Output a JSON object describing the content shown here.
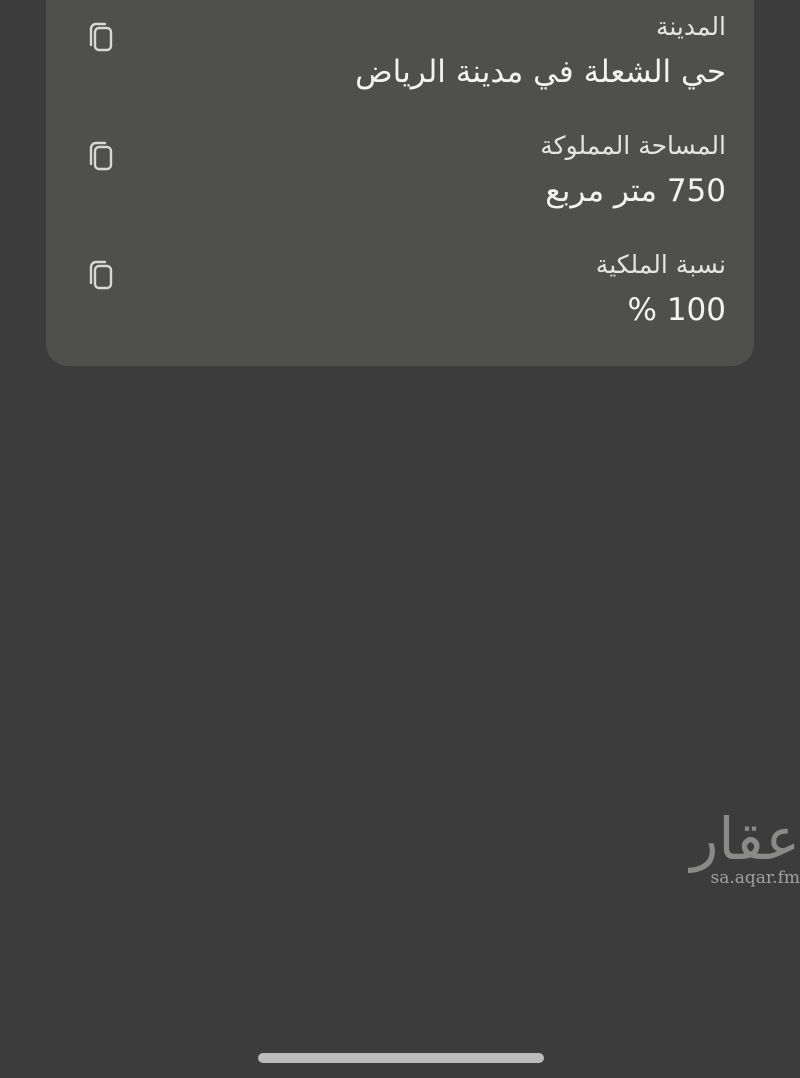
{
  "details": {
    "items": [
      {
        "label": "المدينة",
        "value": "حي الشعلة في  مدينة الرياض"
      },
      {
        "label": "المساحة المملوكة",
        "value": "750 متر مربع"
      },
      {
        "label": "نسبة الملكية",
        "value": "100 %"
      }
    ],
    "copy_icon": "copy-icon"
  },
  "watermark": {
    "logo_text": "عقار",
    "url": "sa.aqar.fm"
  }
}
